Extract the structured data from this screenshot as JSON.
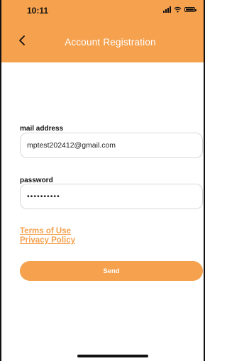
{
  "status_bar": {
    "time": "10:11",
    "icons": [
      "signal-icon",
      "wifi-icon",
      "battery-icon"
    ]
  },
  "header": {
    "title": "Account Registration",
    "back_icon": "chevron-left-icon",
    "background_color": "#f5a14e"
  },
  "form": {
    "email_label": "mail address",
    "email_value": "mptest202412@gmail.com",
    "password_label": "password",
    "password_value": "••••••••••"
  },
  "links": {
    "terms": "Terms of Use",
    "privacy": "Privacy Policy"
  },
  "actions": {
    "send_label": "Send"
  },
  "colors": {
    "accent": "#f5a14e",
    "text": "#111111",
    "border": "#d8d8d8"
  }
}
